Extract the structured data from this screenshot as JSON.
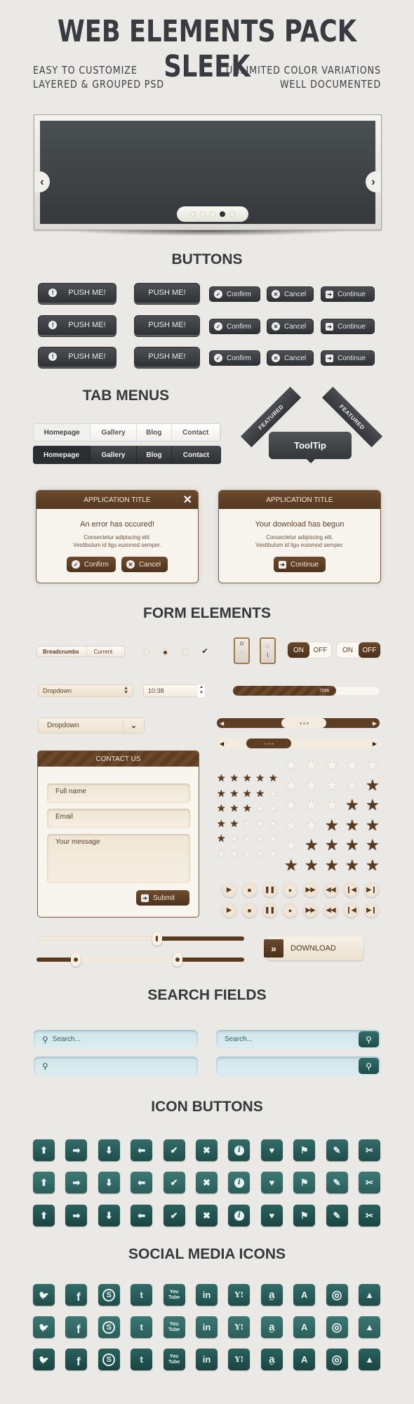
{
  "header": {
    "title": "WEB ELEMENTS PACK SLEEK",
    "features_left": [
      "EASY TO CUSTOMIZE",
      "LAYERED & GROUPED PSD"
    ],
    "features_right": [
      "UNLIMITED COLOR VARIATIONS",
      "WELL DOCUMENTED"
    ]
  },
  "colors": {
    "dark": "#35393c",
    "brown": "#5a3b20",
    "teal": "#2a5e5a",
    "background": "#ebe9e5"
  },
  "slider": {
    "prev_icon": "‹",
    "next_icon": "›",
    "slide_count": 5,
    "active_slide": 4
  },
  "sections": {
    "buttons": "BUTTONS",
    "tab_menus": "TAB MENUS",
    "form_elements": "FORM ELEMENTS",
    "search_fields": "SEARCH FIELDS",
    "icon_buttons": "ICON BUTTONS",
    "social_media": "SOCIAL MEDIA ICONS"
  },
  "buttons": {
    "push_label": "PUSH ME!",
    "alert_icon": "!",
    "confirm": "Confirm",
    "cancel": "Cancel",
    "continue": "Continue",
    "check_icon": "✓",
    "x_icon": "✕",
    "arrow_icon": "➜"
  },
  "tabs": {
    "items": [
      "Homepage",
      "Gallery",
      "Blog",
      "Contact"
    ],
    "active": "Homepage"
  },
  "ribbons": {
    "label": "FEATURED"
  },
  "tooltip": {
    "label": "ToolTip"
  },
  "dialogs": [
    {
      "title": "APPLICATION TITLE",
      "message": "An error has occured!",
      "body": [
        "Consectetur adipiscing elit.",
        "Vestibulum id ligu euismod semper."
      ],
      "buttons": [
        "Confirm",
        "Cancel"
      ],
      "close_icon": "✕"
    },
    {
      "title": "APPLICATION TITLE",
      "message": "Your download has begun",
      "body": [
        "Consectetur adipiscing elit.",
        "Vestibulum id ligu euismod semper."
      ],
      "buttons": [
        "Continue"
      ]
    }
  ],
  "form": {
    "breadcrumbs": [
      "Breadcrumbs",
      "Current"
    ],
    "rocker_labels": [
      "O",
      "I"
    ],
    "toggle_on": "ON",
    "toggle_off": "OFF",
    "select_value": "Dropdown",
    "time_value": "10:38",
    "progress_label": "70%",
    "progress_value": 0.7,
    "dropdown_value": "Dropdown",
    "scrollbar1_position": 0.55,
    "scrollbar2_position": 0.25
  },
  "contact": {
    "title": "CONTACT US",
    "name_placeholder": "Full name",
    "email_placeholder": "Email",
    "message_placeholder": "Your message",
    "submit": "Submit"
  },
  "ratings": {
    "small": [
      5,
      4,
      3,
      2,
      1,
      0
    ],
    "large": [
      0,
      1,
      2,
      3,
      4,
      5
    ],
    "max": 5
  },
  "media_controls": [
    "play",
    "stop",
    "pause",
    "record",
    "fast-forward",
    "rewind",
    "skip-back",
    "skip-forward"
  ],
  "media_glyphs": [
    "▶",
    "■",
    "❚❚",
    "●",
    "▶▶",
    "◀◀",
    "❙◀",
    "▶❙"
  ],
  "range_sliders": {
    "single": 0.58,
    "double": [
      0.19,
      0.68
    ]
  },
  "download": {
    "label": "DOWNLOAD",
    "icon": "»"
  },
  "search": {
    "placeholder": "Search...",
    "icon": "⚲"
  },
  "icon_buttons": {
    "names": [
      "arrow-up",
      "arrow-right",
      "arrow-down",
      "arrow-left",
      "check",
      "close",
      "info",
      "heart",
      "flag",
      "edit",
      "tools"
    ],
    "glyphs": [
      "⬆",
      "➡",
      "⬇",
      "⬅",
      "✔",
      "✖",
      "i",
      "♥",
      "⚑",
      "✎",
      "✂"
    ]
  },
  "social_icons": {
    "names": [
      "twitter",
      "facebook",
      "skype",
      "tumblr",
      "youtube",
      "linkedin",
      "yahoo",
      "amazon",
      "app-store",
      "dribbble",
      "forrst"
    ],
    "glyphs": [
      "🐦",
      "f",
      "S",
      "t",
      "You Tube",
      "in",
      "Y!",
      "a",
      "A",
      "◎",
      "▲"
    ]
  }
}
